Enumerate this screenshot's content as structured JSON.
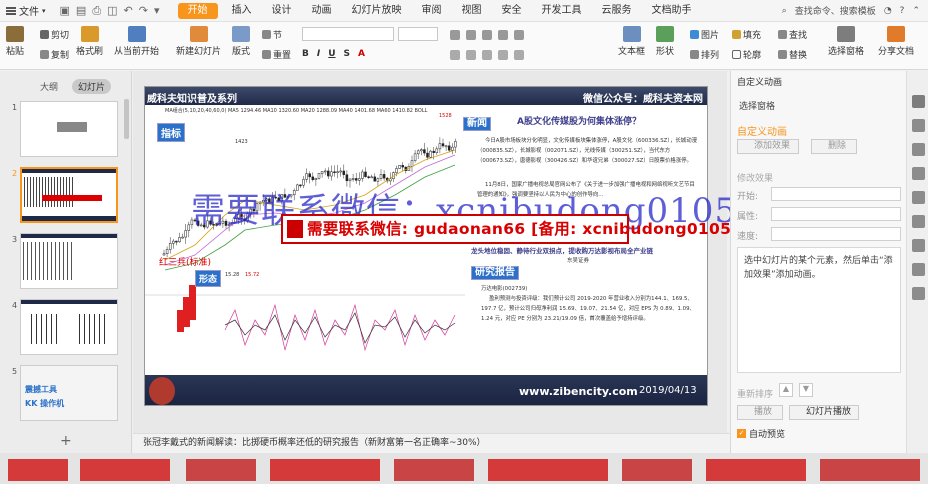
{
  "menu": {
    "file": "文件",
    "tabs": [
      "开始",
      "插入",
      "设计",
      "动画",
      "幻灯片放映",
      "审阅",
      "视图",
      "安全",
      "开发工具",
      "云服务",
      "文档助手"
    ],
    "active_tab": "开始",
    "search": "查找命令、搜索模板"
  },
  "ribbon": {
    "paste": "粘贴",
    "cut": "剪切",
    "copy": "复制",
    "format_painter": "格式刷",
    "from_current": "从当前开始",
    "new_slide": "新建幻灯片",
    "layout": "版式",
    "section": "节",
    "reset": "重置",
    "textbox": "文本框",
    "shape": "形状",
    "arrange": "排列",
    "picture": "图片",
    "fill": "填充",
    "outline": "轮廓",
    "find": "查找",
    "replace": "替换",
    "select_pane": "选择窗格",
    "share": "分享文档"
  },
  "left_panel": {
    "tabs": [
      "大纲",
      "幻灯片"
    ],
    "active_tab": "幻灯片",
    "slide_numbers": [
      "1",
      "2",
      "3",
      "4",
      "5"
    ],
    "thumb5_text": [
      "震撼工具",
      "KK 操作机"
    ]
  },
  "slide": {
    "header_left": "威科夫知识普及系列",
    "header_right": "微信公众号：威科夫资本网",
    "badge_indicator": "指标",
    "badge_news": "新闻",
    "badge_form": "形态",
    "badge_research": "研究报告",
    "ma_line": "MA组合(5,10,20,40,60,0)  MA5 1294.46  MA10 1320.60  MA20 1288.09  MA40 1401.68  MA60 1410.82  BOLL",
    "label_1423": "1423",
    "label_1528": "1528",
    "label_red3": "红三兵(标准)",
    "label_1528b": "15.28",
    "label_1572": "15.72",
    "article_title": "A股文化传媒股为何集体涨停？",
    "article_p1": "今日A股市场板块分化明显，文化传媒板块集体涨停，A股文化（600336.SZ），长城动漫（000835.SZ），长城影视（002071.SZ），光线传媒（300251.SZ），当代东方（000673.SZ），唐德影视（300426.SZ）和华谊兄弟（300027.SZ）日股票价格涨停。",
    "article_p2": "11月8日，国家广播电视总局官网公布了《关于进一步加强广播电视和网络视听文艺节目管理的通知》，强调要坚持以人民为中心的创作导向...",
    "article_head2": "龙头地位稳固、静待行业双拐点，提收购万达影视布局全产业链",
    "article_author": "东吴证券",
    "article_p3": "万达电影(002739)",
    "article_p4": "盈利预测与投资评级：我们预计公司 2019-2020 年营业收入分别为144.1、169.5、197.7 亿，预计公司归母净利润 15.69、19.07、21.54 亿，对应 EPS 为 0.89、1.09、1.24 元，对应 PE 分别为 23.21/19.09 倍，首次覆盖给予增持评级。",
    "footer_url": "www.zibencity.com",
    "footer_date": "2019/04/13"
  },
  "watermark": {
    "blue": "需要联系微信：xcnibudong0105",
    "red": "需要联系微信: gudaonan66 [备用: xcnibudong0105]"
  },
  "right_panel": {
    "title": "自定义动画",
    "select_pane": "选择窗格",
    "custom_anim": "自定义动画",
    "add_effect": "添加效果",
    "delete": "删除",
    "modify_effect": "修改效果",
    "start": "开始:",
    "property": "属性:",
    "speed": "速度:",
    "hint": "选中幻灯片的某个元素，然后单击“添加效果”添加动画。",
    "reorder": "重新排序",
    "play": "播放",
    "slideshow": "幻灯片播放",
    "autopreview": "自动预览"
  },
  "notes": {
    "text": "张冠李戴式的新闻解读：比掷硬币概率还低的研究报告（新财富第一名正确率~30%）"
  },
  "colors": {
    "accent": "#f7951d",
    "header": "#1f2a48",
    "badge": "#2b70c9",
    "watermark_blue": "#2828c8",
    "watermark_red": "#d80000"
  }
}
